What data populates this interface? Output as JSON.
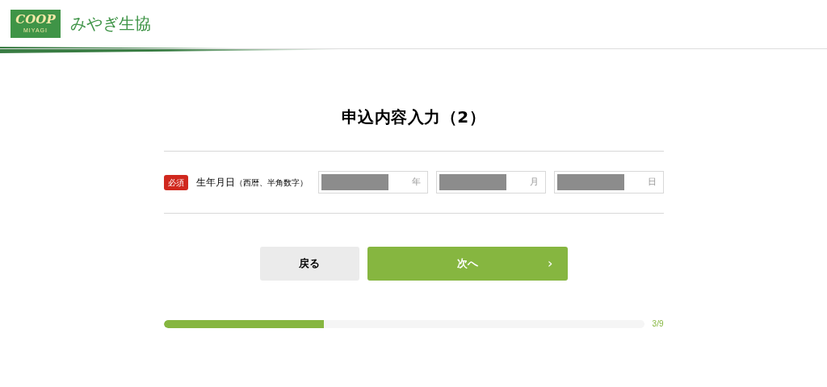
{
  "header": {
    "logo": {
      "word": "COOP",
      "sub": "MIYAGI"
    },
    "brand": "みやぎ生協"
  },
  "title": "申込内容入力（2）",
  "form": {
    "rows": [
      {
        "badge": "必須",
        "label": "生年月日",
        "note": "（西暦、半角数字）",
        "fields": [
          {
            "unit": "年",
            "masked": true
          },
          {
            "unit": "月",
            "masked": true
          },
          {
            "unit": "日",
            "masked": true
          }
        ]
      }
    ]
  },
  "buttons": {
    "back": "戻る",
    "next": "次へ",
    "next_arrow": "›"
  },
  "progress": {
    "level": 0.333,
    "reading": "3/9"
  }
}
